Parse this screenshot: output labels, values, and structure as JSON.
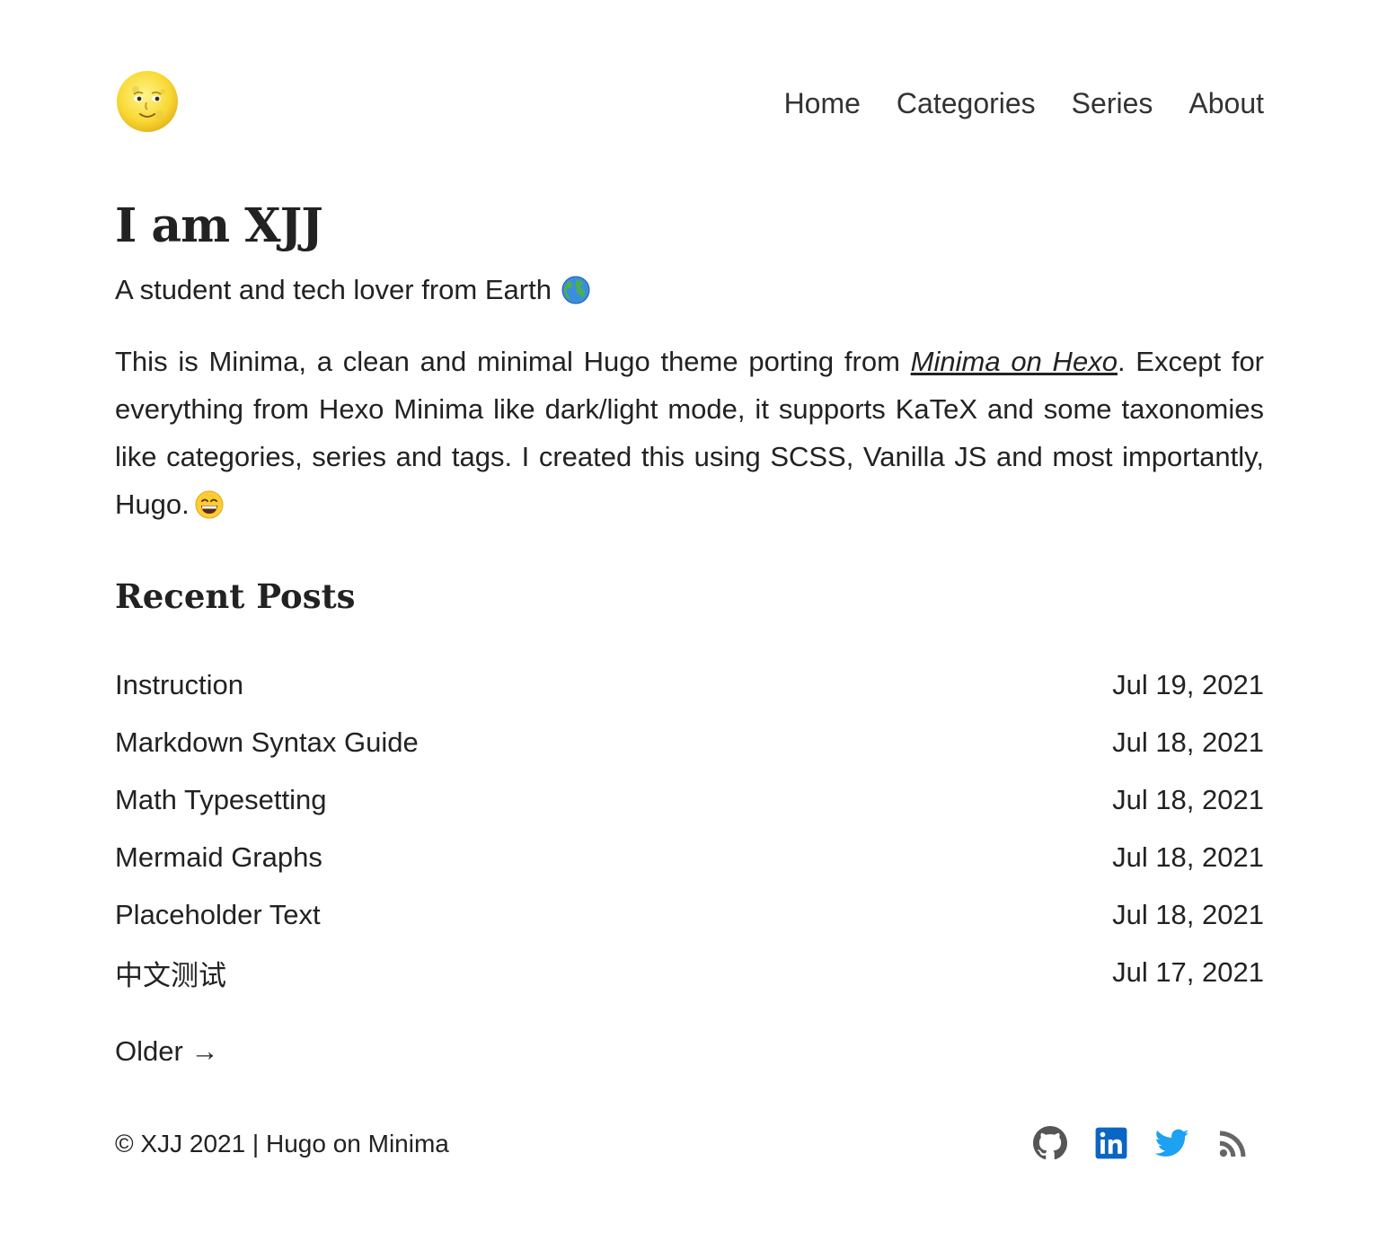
{
  "header": {
    "logo": "full-moon-face",
    "nav": [
      {
        "label": "Home"
      },
      {
        "label": "Categories"
      },
      {
        "label": "Series"
      },
      {
        "label": "About"
      }
    ]
  },
  "intro": {
    "title": "I am XJJ",
    "subtitle": "A student and tech lover from Earth",
    "subtitle_icon": "globe-icon",
    "text_before_link": "This is Minima, a clean and minimal Hugo theme porting from ",
    "link_text": "Minima on Hexo",
    "text_after_link": ". Except for everything from Hexo Minima like dark/light mode, it supports KaTeX and some taxonomies like categories, series and tags. I created this using SCSS, Vanilla JS and most importantly, Hugo.",
    "trailing_icon": "grinning-face-icon"
  },
  "recent_posts": {
    "heading": "Recent Posts",
    "items": [
      {
        "title": "Instruction",
        "date": "Jul 19, 2021"
      },
      {
        "title": "Markdown Syntax Guide",
        "date": "Jul 18, 2021"
      },
      {
        "title": "Math Typesetting",
        "date": "Jul 18, 2021"
      },
      {
        "title": "Mermaid Graphs",
        "date": "Jul 18, 2021"
      },
      {
        "title": "Placeholder Text",
        "date": "Jul 18, 2021"
      },
      {
        "title": "中文测试",
        "date": "Jul 17, 2021"
      }
    ],
    "older_label": "Older →"
  },
  "footer": {
    "copyright": "© XJJ 2021 | Hugo on Minima",
    "socials": [
      {
        "icon": "github-icon",
        "color": "#555555"
      },
      {
        "icon": "linkedin-icon",
        "color": "#0a66c2"
      },
      {
        "icon": "twitter-icon",
        "color": "#1da1f2"
      },
      {
        "icon": "rss-icon",
        "color": "#666666"
      }
    ]
  }
}
